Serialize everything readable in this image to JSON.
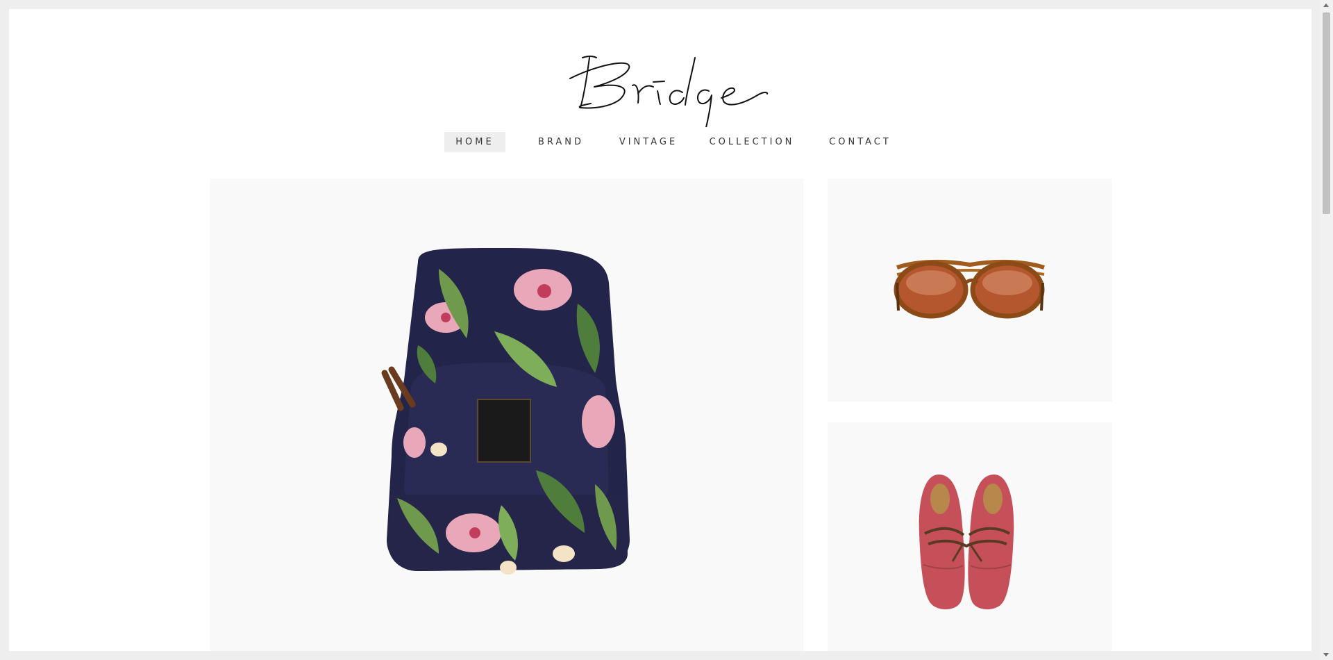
{
  "site": {
    "logo_text": "Bridge"
  },
  "nav": {
    "items": [
      {
        "label": "HOME",
        "active": true
      },
      {
        "label": "BRAND",
        "active": false
      },
      {
        "label": "VINTAGE",
        "active": false
      },
      {
        "label": "COLLECTION",
        "active": false
      },
      {
        "label": "CONTACT",
        "active": false
      }
    ]
  },
  "gallery": {
    "items": [
      {
        "product": "floral-backpack",
        "icon": "backpack-image"
      },
      {
        "product": "tortoiseshell-sunglasses",
        "icon": "sunglasses-image"
      },
      {
        "product": "red-leather-shoes",
        "icon": "shoes-image"
      }
    ]
  },
  "colors": {
    "background": "#eeeeee",
    "page": "#ffffff",
    "tile": "#f9f9f9",
    "nav_text": "#333333",
    "nav_active_bg": "#eeeeee"
  }
}
